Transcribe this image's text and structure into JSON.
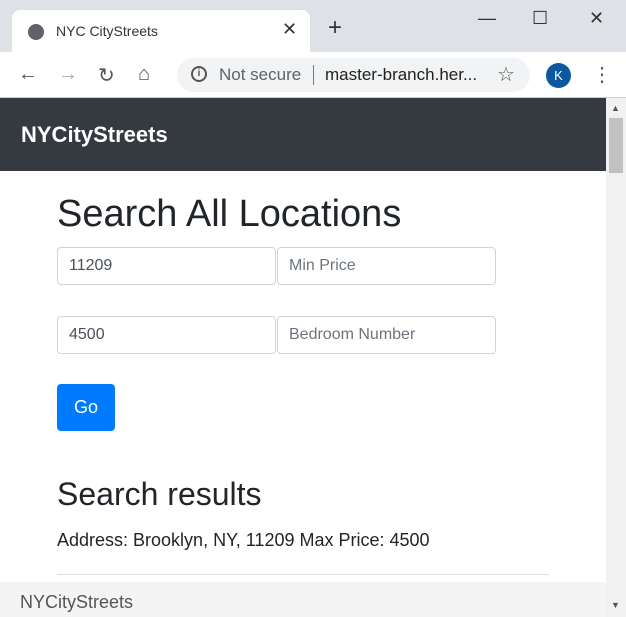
{
  "browser": {
    "tab_title": "NYC CityStreets",
    "not_secure": "Not secure",
    "url": "master-branch.her...",
    "avatar_letter": "K"
  },
  "navbar": {
    "brand": "NYCityStreets"
  },
  "search": {
    "heading": "Search All Locations",
    "zip_value": "11209",
    "min_price_placeholder": "Min Price",
    "max_price_value": "4500",
    "bedroom_placeholder": "Bedroom Number",
    "go_label": "Go"
  },
  "results": {
    "heading": "Search results",
    "summary": "Address: Brooklyn, NY, 11209 Max Price: 4500"
  },
  "footer": {
    "text": "NYCityStreets"
  },
  "colors": {
    "navbar": "#343a40",
    "primary": "#007bff"
  }
}
